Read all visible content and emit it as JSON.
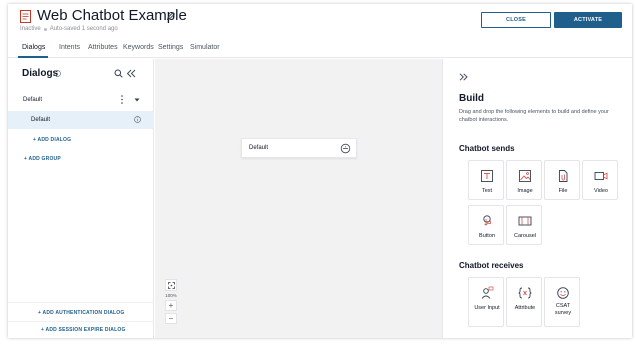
{
  "header": {
    "title": "Web Chatbot Example",
    "status": "Inactive",
    "autosave": "Auto-saved 1 second ago",
    "close_label": "CLOSE",
    "activate_label": "ACTIVATE"
  },
  "tabs": [
    {
      "label": "Dialogs"
    },
    {
      "label": "Intents"
    },
    {
      "label": "Attributes"
    },
    {
      "label": "Keywords"
    },
    {
      "label": "Settings"
    },
    {
      "label": "Simulator"
    }
  ],
  "left_panel": {
    "title": "Dialogs",
    "group_name": "Default",
    "dialog_name": "Default",
    "add_dialog": "+ ADD DIALOG",
    "add_group": "+ ADD GROUP",
    "add_auth_dialog": "+ ADD AUTHENTICATION DIALOG",
    "add_session_dialog": "+ ADD SESSION EXPIRE DIALOG"
  },
  "canvas": {
    "node_label": "Default",
    "zoom_level": "100%"
  },
  "right_panel": {
    "title": "Build",
    "description": "Drag and drop the following elements to build and define your chatbot interactions.",
    "sends_title": "Chatbot sends",
    "sends": [
      {
        "label": "Text",
        "icon": "text-icon"
      },
      {
        "label": "Image",
        "icon": "image-icon"
      },
      {
        "label": "File",
        "icon": "file-icon"
      },
      {
        "label": "Video",
        "icon": "video-icon"
      },
      {
        "label": "Button",
        "icon": "button-icon"
      },
      {
        "label": "Carousel",
        "icon": "carousel-icon"
      }
    ],
    "receives_title": "Chatbot receives",
    "receives": [
      {
        "label": "User Input",
        "icon": "user-input-icon"
      },
      {
        "label": "Attribute",
        "icon": "attribute-icon"
      },
      {
        "label": "CSAT survey",
        "icon": "csat-icon"
      }
    ]
  },
  "colors": {
    "primary": "#1e5f8c",
    "selected_row": "#e6f0f8",
    "canvas_bg": "#f2f2f2",
    "icon_accent": "#d9534f"
  }
}
